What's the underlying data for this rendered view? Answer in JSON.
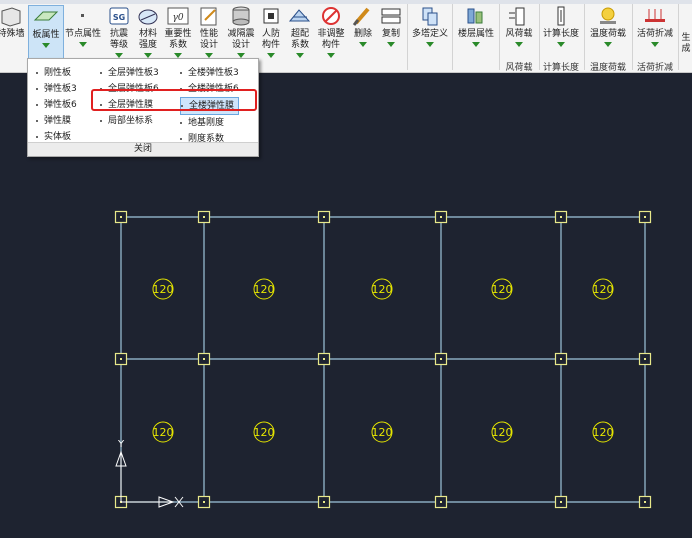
{
  "ribbon": {
    "buttons": [
      {
        "id": "wall",
        "label": "特殊墙",
        "icon": "wall-icon"
      },
      {
        "id": "slab",
        "label": "板属性",
        "icon": "slab-icon"
      },
      {
        "id": "node",
        "label": "节点属性",
        "icon": "node-icon"
      },
      {
        "id": "seismic",
        "label": "抗震\n等级",
        "icon": "sg-icon"
      },
      {
        "id": "material",
        "label": "材料\n强度",
        "icon": "material-icon"
      },
      {
        "id": "importance",
        "label": "重要性\n系数",
        "icon": "gamma-icon"
      },
      {
        "id": "performance",
        "label": "性能\n设计",
        "icon": "performance-icon"
      },
      {
        "id": "damping",
        "label": "减隔震\n设计",
        "icon": "damping-icon"
      },
      {
        "id": "civil",
        "label": "人防\n构件",
        "icon": "civil-defense-icon"
      },
      {
        "id": "overcoef",
        "label": "超配\n系数",
        "icon": "overcoef-icon"
      },
      {
        "id": "nonadjust",
        "label": "非调整\n构件",
        "icon": "nonadjust-icon"
      },
      {
        "id": "delete",
        "label": "删除",
        "icon": "delete-icon"
      },
      {
        "id": "copy",
        "label": "复制",
        "icon": "copy-icon"
      },
      {
        "id": "multitower",
        "label": "多塔定义",
        "icon": "multitower-icon"
      },
      {
        "id": "floorattr",
        "label": "楼层属性",
        "icon": "floor-attr-icon"
      },
      {
        "id": "wind",
        "label": "风荷载",
        "icon": "wind-load-icon"
      },
      {
        "id": "calclen",
        "label": "计算长度",
        "icon": "calc-length-icon"
      },
      {
        "id": "temp",
        "label": "温度荷载",
        "icon": "temperature-icon"
      },
      {
        "id": "liveload",
        "label": "活荷折减",
        "icon": "live-load-icon"
      },
      {
        "id": "last",
        "label": "生\n成",
        "icon": "generate-icon"
      }
    ],
    "groups": [
      "风荷载",
      "计算长度",
      "温度荷载",
      "活荷折减"
    ]
  },
  "dropdown": {
    "col1": [
      "刚性板",
      "弹性板3",
      "弹性板6",
      "弹性膜",
      "实体板"
    ],
    "col2": [
      "全层弹性板3",
      "全层弹性板6",
      "全层弹性膜",
      "局部坐标系"
    ],
    "col3": [
      "全楼弹性板3",
      "全楼弹性板6",
      "全楼弹性膜",
      "地基刚度",
      "刚度系数"
    ],
    "close": "关闭"
  },
  "canvas": {
    "slab_label": "120",
    "axis_y": "Y",
    "colors": {
      "grid": "#9ec5db",
      "node": "#e8e88a",
      "label": "#e6e600",
      "bg": "#1e2330"
    }
  }
}
